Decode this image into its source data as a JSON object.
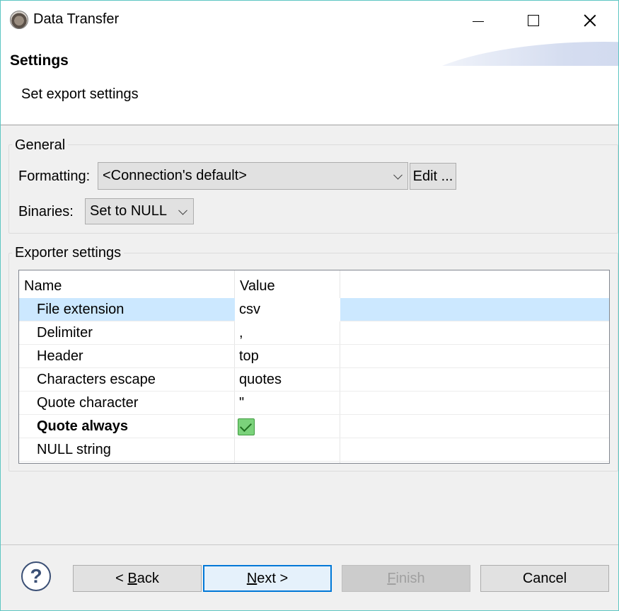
{
  "window": {
    "title": "Data Transfer",
    "icon": "dbeaver-beaver-icon"
  },
  "header": {
    "title": "Settings",
    "subtitle": "Set export settings"
  },
  "general": {
    "group_label": "General",
    "formatting_label": "Formatting:",
    "formatting_value": "<Connection's default>",
    "edit_button": "Edit ...",
    "binaries_label": "Binaries:",
    "binaries_value": "Set to NULL"
  },
  "exporter": {
    "group_label": "Exporter settings",
    "columns": [
      "Name",
      "Value"
    ],
    "rows": [
      {
        "name": "File extension",
        "value": "csv",
        "selected": true
      },
      {
        "name": "Delimiter",
        "value": ","
      },
      {
        "name": "Header",
        "value": "top"
      },
      {
        "name": "Characters escape",
        "value": "quotes"
      },
      {
        "name": "Quote character",
        "value": "\""
      },
      {
        "name": "Quote always",
        "value": "",
        "bold": true,
        "checked": true
      },
      {
        "name": "NULL string",
        "value": ""
      }
    ]
  },
  "footer": {
    "help": "?",
    "back_prefix": "< ",
    "back_mnemonic": "B",
    "back_rest": "ack",
    "next_mnemonic": "N",
    "next_rest": "ext >",
    "finish_mnemonic": "F",
    "finish_rest": "inish",
    "cancel": "Cancel"
  },
  "colors": {
    "selection": "#cce8ff",
    "accent": "#0078d7",
    "checkbox": "#7bd27b"
  }
}
